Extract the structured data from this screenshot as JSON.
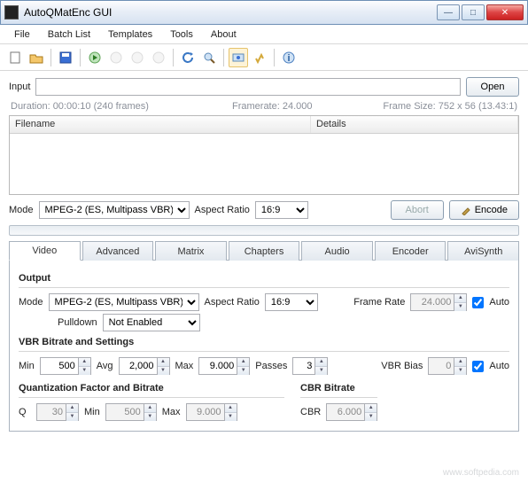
{
  "window": {
    "title": "AutoQMatEnc GUI"
  },
  "menu": {
    "file": "File",
    "batch": "Batch List",
    "templates": "Templates",
    "tools": "Tools",
    "about": "About"
  },
  "input": {
    "label": "Input",
    "value": "",
    "open": "Open",
    "duration": "Duration: 00:00:10 (240 frames)",
    "framerate": "Framerate: 24.000",
    "framesize": "Frame Size: 752 x 56 (13.43:1)"
  },
  "list": {
    "col_filename": "Filename",
    "col_details": "Details"
  },
  "mode_row": {
    "mode_label": "Mode",
    "mode_value": "MPEG-2 (ES, Multipass VBR)",
    "ar_label": "Aspect Ratio",
    "ar_value": "16:9",
    "abort": "Abort",
    "encode": "Encode"
  },
  "tabs": {
    "video": "Video",
    "advanced": "Advanced",
    "matrix": "Matrix",
    "chapters": "Chapters",
    "audio": "Audio",
    "encoder": "Encoder",
    "avisynth": "AviSynth"
  },
  "video": {
    "output_title": "Output",
    "mode_label": "Mode",
    "mode_value": "MPEG-2 (ES, Multipass VBR)",
    "ar_label": "Aspect Ratio",
    "ar_value": "16:9",
    "fr_label": "Frame Rate",
    "fr_value": "24.000",
    "fr_auto": "Auto",
    "pulldown_label": "Pulldown",
    "pulldown_value": "Not Enabled",
    "vbr_title": "VBR Bitrate and Settings",
    "min_label": "Min",
    "min_value": "500",
    "avg_label": "Avg",
    "avg_value": "2,000",
    "max_label": "Max",
    "max_value": "9.000",
    "passes_label": "Passes",
    "passes_value": "3",
    "bias_label": "VBR Bias",
    "bias_value": "0",
    "bias_auto": "Auto",
    "quant_title": "Quantization Factor and Bitrate",
    "q_label": "Q",
    "q_value": "30",
    "qmin_label": "Min",
    "qmin_value": "500",
    "qmax_label": "Max",
    "qmax_value": "9.000",
    "cbr_title": "CBR Bitrate",
    "cbr_label": "CBR",
    "cbr_value": "6.000"
  },
  "footer": "www.softpedia.com"
}
